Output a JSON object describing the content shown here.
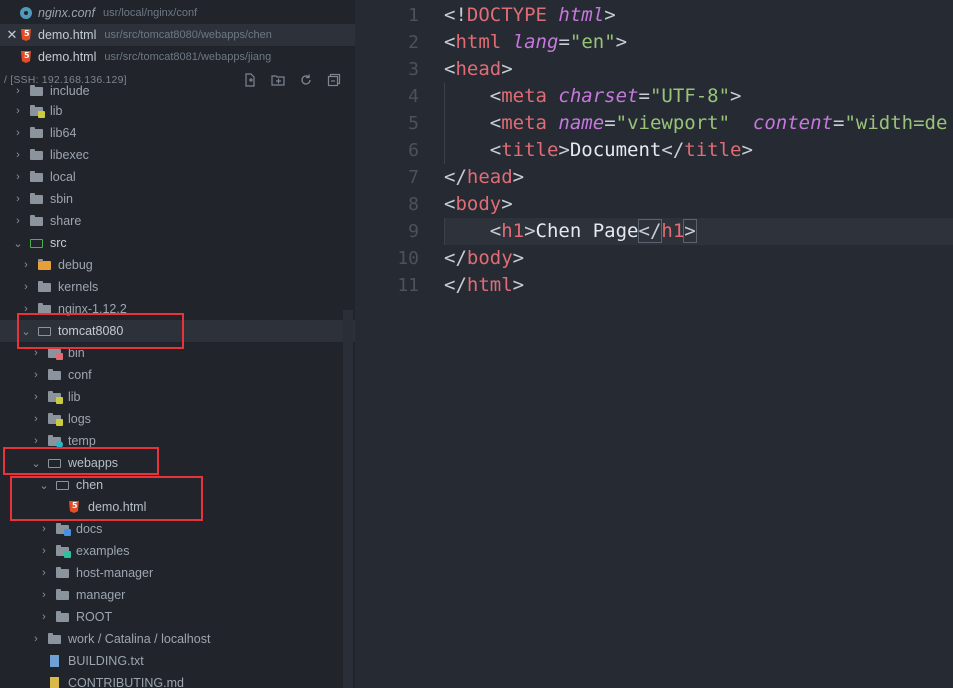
{
  "open_files": [
    {
      "name": "nginx.conf",
      "path": "usr/local/nginx/conf",
      "icon": "gear-icon",
      "active": false
    },
    {
      "name": "demo.html",
      "path": "usr/src/tomcat8080/webapps/chen",
      "icon": "html5-icon",
      "active": true,
      "close": "✕"
    },
    {
      "name": "demo.html",
      "path": "usr/src/tomcat8081/webapps/jiang",
      "icon": "html5-icon",
      "active": false
    }
  ],
  "explorer": {
    "title": "/ [SSH: 192.168.136.129]",
    "actions": [
      "new-file-icon",
      "new-folder-icon",
      "refresh-icon",
      "collapse-all-icon"
    ]
  },
  "tree": [
    {
      "label": "include"
    },
    {
      "label": "lib"
    },
    {
      "label": "lib64"
    },
    {
      "label": "libexec"
    },
    {
      "label": "local"
    },
    {
      "label": "sbin"
    },
    {
      "label": "share"
    },
    {
      "label": "src"
    },
    {
      "label": "debug"
    },
    {
      "label": "kernels"
    },
    {
      "label": "nginx-1.12.2"
    },
    {
      "label": "tomcat8080"
    },
    {
      "label": "bin"
    },
    {
      "label": "conf"
    },
    {
      "label": "lib"
    },
    {
      "label": "logs"
    },
    {
      "label": "temp"
    },
    {
      "label": "webapps"
    },
    {
      "label": "chen"
    },
    {
      "label": "demo.html"
    },
    {
      "label": "docs"
    },
    {
      "label": "examples"
    },
    {
      "label": "host-manager"
    },
    {
      "label": "manager"
    },
    {
      "label": "ROOT"
    },
    {
      "label": "work / Catalina / localhost"
    },
    {
      "label": "BUILDING.txt"
    },
    {
      "label": "CONTRIBUTING.md"
    }
  ],
  "editor": {
    "line_numbers": [
      "1",
      "2",
      "3",
      "4",
      "5",
      "6",
      "7",
      "8",
      "9",
      "10",
      "11"
    ],
    "lines": [
      [
        [
          "t-punc",
          "<!"
        ],
        [
          "t-doct",
          "DOCTYPE"
        ],
        [
          "t-punc",
          " "
        ],
        [
          "t-attr",
          "html"
        ],
        [
          "t-punc",
          ">"
        ]
      ],
      [
        [
          "t-punc",
          "<"
        ],
        [
          "t-tag",
          "html"
        ],
        [
          "t-punc",
          " "
        ],
        [
          "t-attr",
          "lang"
        ],
        [
          "t-punc",
          "="
        ],
        [
          "t-str",
          "\"en\""
        ],
        [
          "t-punc",
          ">"
        ]
      ],
      [
        [
          "t-punc",
          "<"
        ],
        [
          "t-tag",
          "head"
        ],
        [
          "t-punc",
          ">"
        ]
      ],
      [
        [
          "t-punc",
          "    <"
        ],
        [
          "t-tag",
          "meta"
        ],
        [
          "t-punc",
          " "
        ],
        [
          "t-attr",
          "charset"
        ],
        [
          "t-punc",
          "="
        ],
        [
          "t-str",
          "\"UTF-8\""
        ],
        [
          "t-punc",
          ">"
        ]
      ],
      [
        [
          "t-punc",
          "    <"
        ],
        [
          "t-tag",
          "meta"
        ],
        [
          "t-punc",
          " "
        ],
        [
          "t-attr",
          "name"
        ],
        [
          "t-punc",
          "="
        ],
        [
          "t-str",
          "\"viewport\""
        ],
        [
          "t-punc",
          "  "
        ],
        [
          "t-attr",
          "content"
        ],
        [
          "t-punc",
          "="
        ],
        [
          "t-str",
          "\"width=de"
        ]
      ],
      [
        [
          "t-punc",
          "    <"
        ],
        [
          "t-tag",
          "title"
        ],
        [
          "t-punc",
          ">"
        ],
        [
          "t-text",
          "Document"
        ],
        [
          "t-punc",
          "</"
        ],
        [
          "t-tag",
          "title"
        ],
        [
          "t-punc",
          ">"
        ]
      ],
      [
        [
          "t-punc",
          "</"
        ],
        [
          "t-tag",
          "head"
        ],
        [
          "t-punc",
          ">"
        ]
      ],
      [
        [
          "t-punc",
          "<"
        ],
        [
          "t-tag",
          "body"
        ],
        [
          "t-punc",
          ">"
        ]
      ],
      [
        [
          "t-punc",
          "    <"
        ],
        [
          "t-tag",
          "h1"
        ],
        [
          "t-punc",
          ">"
        ],
        [
          "t-text",
          "Chen Page"
        ],
        [
          "t-punc",
          "</"
        ],
        [
          "t-tag",
          "h1"
        ],
        [
          "t-punc",
          ">"
        ]
      ],
      [
        [
          "t-punc",
          "</"
        ],
        [
          "t-tag",
          "body"
        ],
        [
          "t-punc",
          ">"
        ]
      ],
      [
        [
          "t-punc",
          "</"
        ],
        [
          "t-tag",
          "html"
        ],
        [
          "t-punc",
          ">"
        ]
      ]
    ]
  },
  "colors": {
    "highlight_box": "#e8333a",
    "tag": "#e06c75",
    "attribute": "#c678dd",
    "string": "#98c379"
  }
}
